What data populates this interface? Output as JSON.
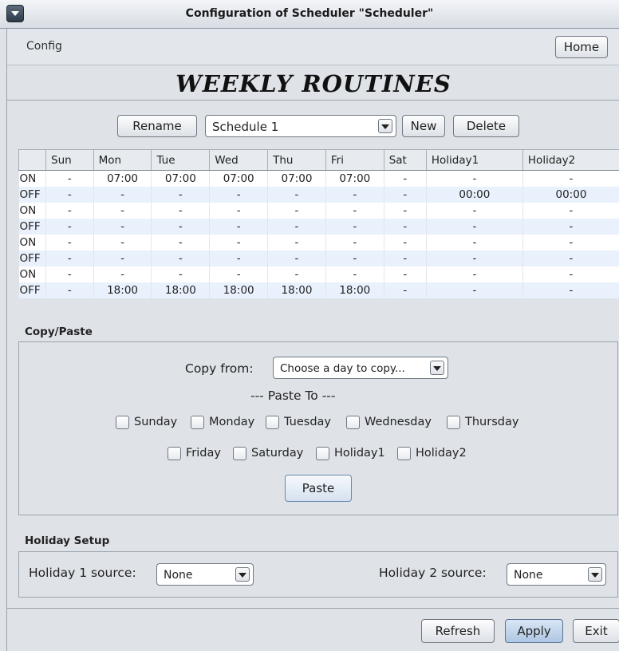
{
  "window": {
    "title": "Configuration of Scheduler \"Scheduler\""
  },
  "menubar": {
    "config": "Config",
    "home": "Home"
  },
  "heading": "WEEKLY ROUTINES",
  "schedule_bar": {
    "rename": "Rename",
    "selected": "Schedule 1",
    "new": "New",
    "delete": "Delete"
  },
  "table": {
    "columns": [
      "Sun",
      "Mon",
      "Tue",
      "Wed",
      "Thu",
      "Fri",
      "Sat",
      "Holiday1",
      "Holiday2"
    ],
    "rows": [
      {
        "label": "ON",
        "cells": [
          "-",
          "07:00",
          "07:00",
          "07:00",
          "07:00",
          "07:00",
          "-",
          "-",
          "-"
        ]
      },
      {
        "label": "OFF",
        "cells": [
          "-",
          "-",
          "-",
          "-",
          "-",
          "-",
          "-",
          "00:00",
          "00:00"
        ]
      },
      {
        "label": "ON",
        "cells": [
          "-",
          "-",
          "-",
          "-",
          "-",
          "-",
          "-",
          "-",
          "-"
        ]
      },
      {
        "label": "OFF",
        "cells": [
          "-",
          "-",
          "-",
          "-",
          "-",
          "-",
          "-",
          "-",
          "-"
        ]
      },
      {
        "label": "ON",
        "cells": [
          "-",
          "-",
          "-",
          "-",
          "-",
          "-",
          "-",
          "-",
          "-"
        ]
      },
      {
        "label": "OFF",
        "cells": [
          "-",
          "-",
          "-",
          "-",
          "-",
          "-",
          "-",
          "-",
          "-"
        ]
      },
      {
        "label": "ON",
        "cells": [
          "-",
          "-",
          "-",
          "-",
          "-",
          "-",
          "-",
          "-",
          "-"
        ]
      },
      {
        "label": "OFF",
        "cells": [
          "-",
          "18:00",
          "18:00",
          "18:00",
          "18:00",
          "18:00",
          "-",
          "-",
          "-"
        ]
      }
    ]
  },
  "copy_paste": {
    "section": "Copy/Paste",
    "copy_from_label": "Copy from:",
    "copy_from_value": "Choose a day to copy...",
    "paste_to": "--- Paste To ---",
    "days_row1": [
      "Sunday",
      "Monday",
      "Tuesday",
      "Wednesday",
      "Thursday"
    ],
    "days_row2": [
      "Friday",
      "Saturday",
      "Holiday1",
      "Holiday2"
    ],
    "paste": "Paste"
  },
  "holiday": {
    "section": "Holiday Setup",
    "h1_label": "Holiday 1 source:",
    "h1_value": "None",
    "h2_label": "Holiday 2 source:",
    "h2_value": "None"
  },
  "footer": {
    "refresh": "Refresh",
    "apply": "Apply",
    "exit": "Exit"
  }
}
